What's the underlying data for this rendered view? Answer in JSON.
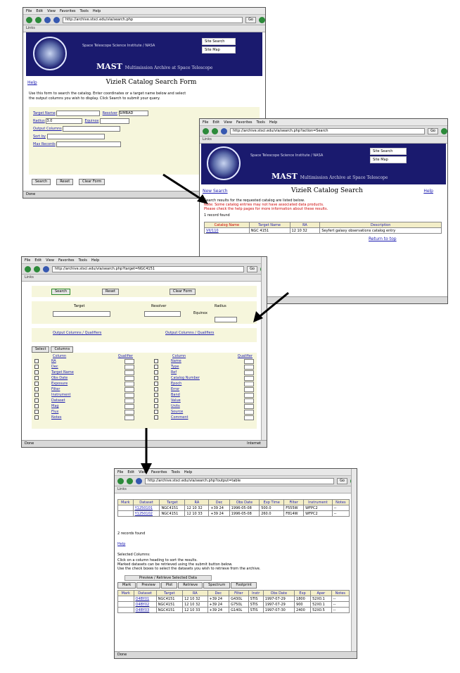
{
  "browser": {
    "menus": [
      "File",
      "Edit",
      "View",
      "Favorites",
      "Tools",
      "Help"
    ],
    "go_label": "Go",
    "links_label": "Links"
  },
  "banner": {
    "institute": "Space Telescope Science Institute / NASA",
    "mast_word": "MAST",
    "mast_sub": "Multimission Archive at Space Telescope",
    "side_link_1": "Site Search",
    "side_link_2": "Site Map"
  },
  "win1": {
    "address": "http://archive.stsci.edu/vla/search.php",
    "page_title": "VizieR Catalog Search Form",
    "help_link": "Help",
    "intro_1": "Use this form to search the catalog. Enter coordinates or a target name below and select",
    "intro_2": "the output columns you wish to display. Click Search to submit your query.",
    "fields": [
      "Target Name",
      "Resolver",
      "Radius",
      "Equinox",
      "Output Columns",
      "Sort by",
      "Max Records"
    ],
    "resolver_value": "SIMBAD",
    "radius_value": "3.0",
    "buttons": [
      "Search",
      "Reset",
      "Clear Form"
    ],
    "status": "Done"
  },
  "win2": {
    "address": "http://archive.stsci.edu/vla/search.php?action=Search",
    "page_title": "VizieR Catalog Search",
    "help_link": "Help",
    "back_link": "New Search",
    "notice_1": "Search results for the requested catalog are listed below.",
    "notice_red_1": "Note: Some catalog entries may not have associated data products.",
    "notice_red_2": "Please check the help pages for more information about these results.",
    "count_label": "1 record found",
    "table_headers": [
      "Catalog Name",
      "Target Name",
      "RA",
      "Description"
    ],
    "table_row": [
      "VII/110",
      "NGC 4151",
      "12 10 32",
      "Seyfert galaxy observations catalog entry"
    ],
    "footer_link": "Return to top"
  },
  "win3": {
    "address": "http://archive.stsci.edu/vla/search.php?target=NGC4151",
    "top_buttons": [
      "Search",
      "Reset",
      "Clear Form"
    ],
    "param_labels": [
      "Target",
      "Resolver",
      "Radius",
      "Equinox"
    ],
    "section_labels": [
      "Output Columns / Qualifiers",
      "Output Columns / Qualifiers"
    ],
    "tabs": [
      "Select",
      "Columns"
    ],
    "col_header": "Column",
    "qual_header": "Qualifier",
    "left_columns": [
      "RA",
      "Dec",
      "Target Name",
      "Obs Date",
      "Exposure",
      "Filter",
      "Instrument",
      "Dataset",
      "Mag",
      "Flux",
      "Notes"
    ],
    "right_columns": [
      "Name",
      "Type",
      "Ref",
      "Catalog Number",
      "Epoch",
      "Error",
      "Band",
      "Value",
      "Units",
      "Source",
      "Comment"
    ],
    "status": "Done",
    "zone": "Internet"
  },
  "win4": {
    "address": "http://archive.stsci.edu/vla/search.php?output=table",
    "table_headers": [
      "Mark",
      "Dataset",
      "Target",
      "RA",
      "Dec",
      "Obs Date",
      "Exp Time",
      "Filter",
      "Instrument",
      "Notes"
    ],
    "rows": [
      [
        "",
        "Y1250101",
        "NGC4151",
        "12 10 32",
        "+39 24",
        "1996-05-08",
        "500.0",
        "F555W",
        "WFPC2",
        "--"
      ],
      [
        "",
        "Y1250102",
        "NGC4151",
        "12 10 33",
        "+39 24",
        "1996-05-08",
        "260.0",
        "F814W",
        "WFPC2",
        "--"
      ]
    ],
    "records_label": "2 records found",
    "link": "Help",
    "notes_label": "Selected Columns:",
    "note_lines": [
      "Click on a column heading to sort the results.",
      "Marked datasets can be retrieved using the submit button below.",
      "Use the check boxes to select the datasets you wish to retrieve from the archive."
    ],
    "sub_title": "Preview / Retrieve Selected Data",
    "sub_tabs": [
      "Mark",
      "Preview",
      "Plot",
      "Retrieve",
      "Spectrum",
      "Footprint"
    ],
    "sub_headers": [
      "Mark",
      "Dataset",
      "Target",
      "RA",
      "Dec",
      "Filter",
      "Instr",
      "Obs Date",
      "Exp",
      "Aper",
      "Notes"
    ],
    "sub_rows": [
      [
        "",
        "O4BY01",
        "NGC4151",
        "12 10 32",
        "+39 24",
        "G430L",
        "STIS",
        "1997-07-29",
        "1800",
        "52X0.1",
        "--"
      ],
      [
        "",
        "O4BY02",
        "NGC4151",
        "12 10 32",
        "+39 24",
        "G750L",
        "STIS",
        "1997-07-29",
        "900",
        "52X0.1",
        "--"
      ],
      [
        "",
        "O4BY03",
        "NGC4151",
        "12 10 33",
        "+39 24",
        "G140L",
        "STIS",
        "1997-07-30",
        "2400",
        "52X0.5",
        "--"
      ]
    ],
    "status": "Done"
  }
}
